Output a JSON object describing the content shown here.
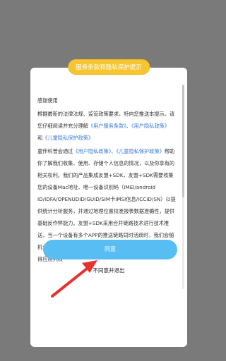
{
  "dialog": {
    "title": "服务条款和隐私保护提示",
    "greeting": "感谢使用",
    "p1_before": "根据最新的法律法规、监管政策要求，特向您推送本提示。请您仔细阅读并充分理解",
    "link_user_service": "《用户服务条款》",
    "sep": "、",
    "link_privacy": "《用户隐私政策》",
    "and": "和",
    "link_child": "《儿童隐私保护政策》",
    "p2_before": "童伴科普会通过",
    "p2_after": "帮助你了解我们收集、使用、存储个人信息的情况，以及你享有的相关权利。我们的产品集成友盟+SDK，友盟+SDK需要收集您的设备Mac地址、唯一设备识别码（IMEI/android ID/IDFA/OPENUDID/GUID/SIM卡IMSI信息/ICCID/SN）以提供统计分析服务，并通过地理位置校准报表数据准确性，提供基础反作弊能力。友盟+SDK采用合并链路技术进行技术推送，当一个设备有多个APP的推送链路同时活跃时，我们会随机合并成一条链路，以达到为您省电省流量的目的，因此需获得应用列表",
    "agree_label": "同意",
    "reject_label": "不同意并退出"
  },
  "colors": {
    "overlay": "#7a7a7a",
    "title_pill": "#f7c531",
    "link": "#3a7bd5",
    "agree_button": "#58bdf3",
    "arrow": "#e8322e"
  }
}
